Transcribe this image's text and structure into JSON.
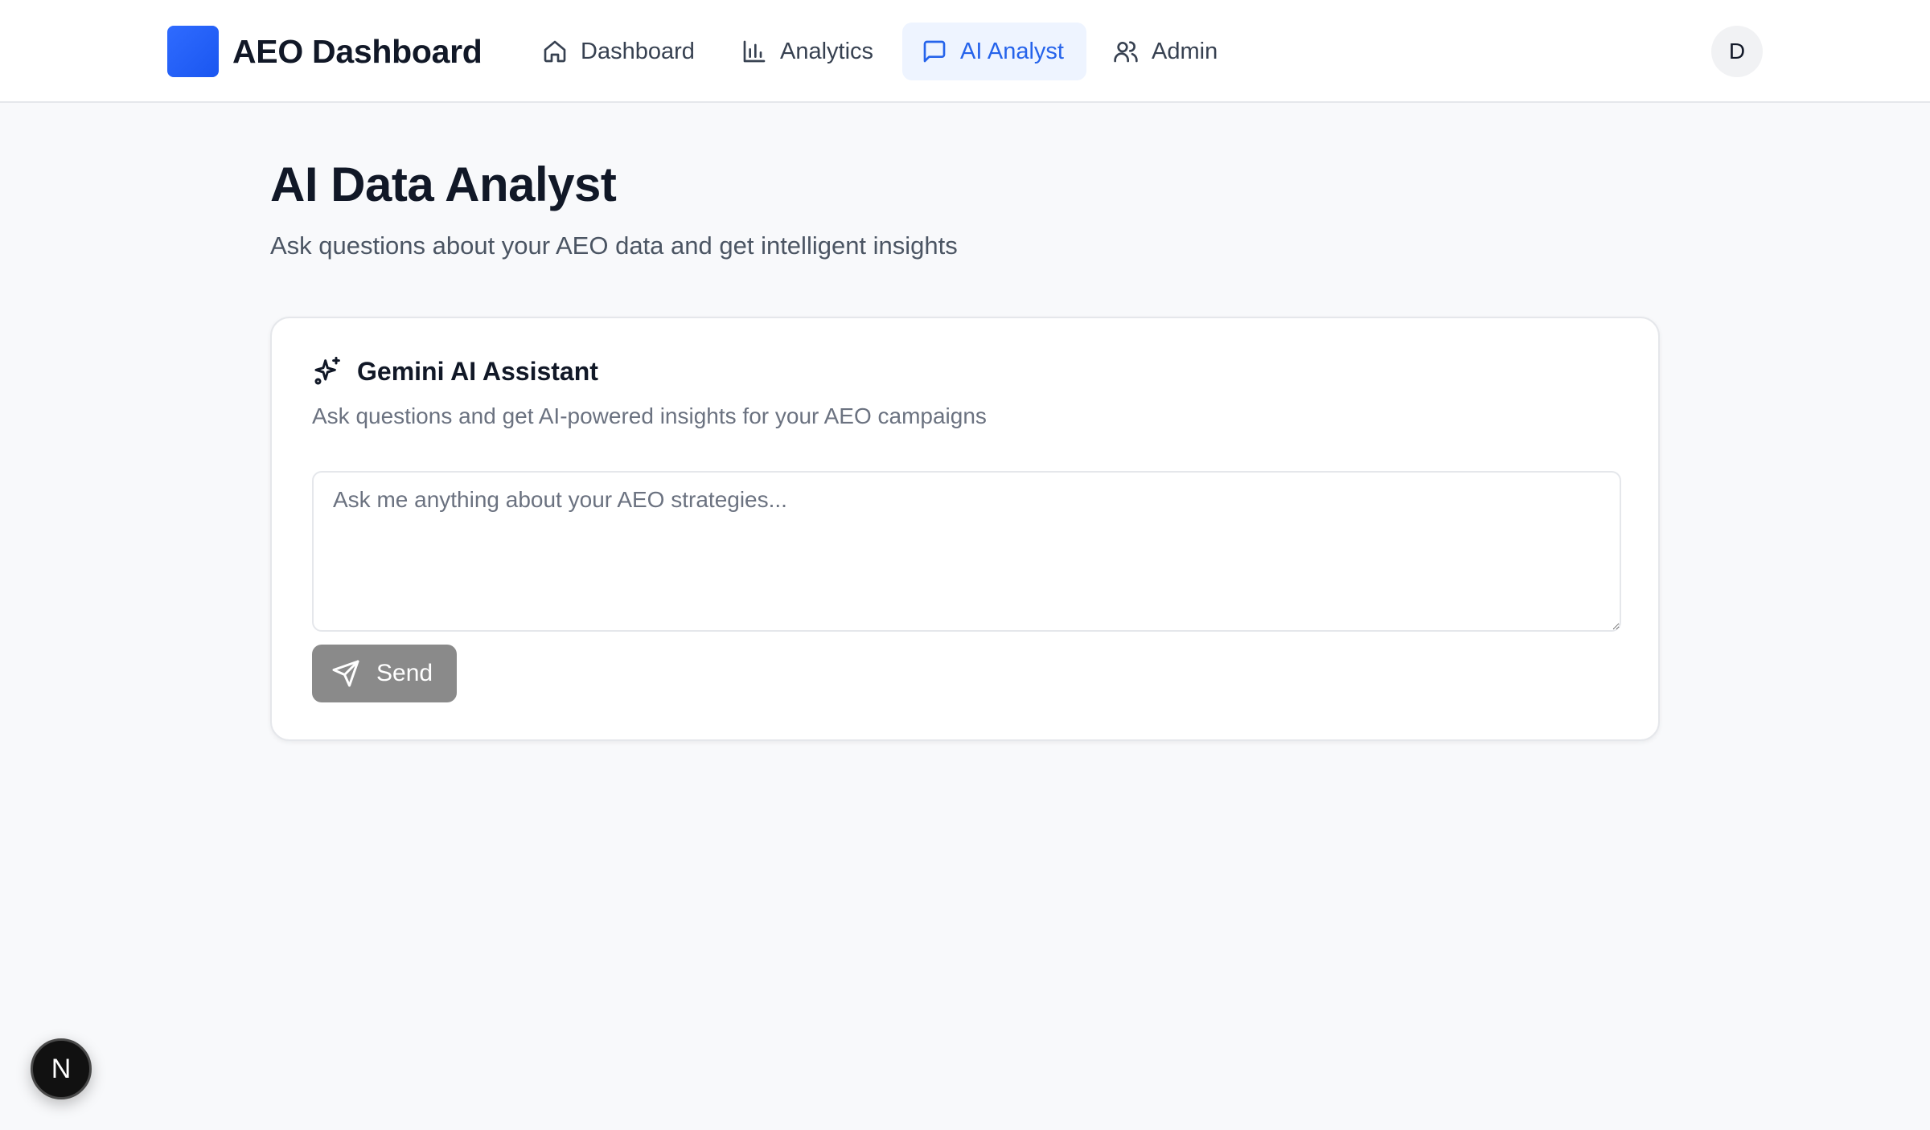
{
  "header": {
    "brand": "AEO Dashboard",
    "nav": [
      {
        "label": "Dashboard",
        "icon": "home-icon",
        "active": false
      },
      {
        "label": "Analytics",
        "icon": "bar-chart-icon",
        "active": false
      },
      {
        "label": "AI Analyst",
        "icon": "message-square-icon",
        "active": true
      },
      {
        "label": "Admin",
        "icon": "users-icon",
        "active": false
      }
    ],
    "avatar_initial": "D"
  },
  "page": {
    "title": "AI Data Analyst",
    "subtitle": "Ask questions about your AEO data and get intelligent insights"
  },
  "assistant": {
    "icon": "sparkles-icon",
    "title": "Gemini AI Assistant",
    "description": "Ask questions and get AI-powered insights for your AEO campaigns",
    "input_value": "",
    "input_placeholder": "Ask me anything about your AEO strategies...",
    "send_label": "Send",
    "send_icon": "send-icon"
  },
  "dev_badge": {
    "label": "N",
    "icon": "nextjs-icon"
  },
  "colors": {
    "accent": "#2563eb",
    "logo": "#1a56f0",
    "active_nav_bg": "#eef4ff",
    "send_disabled": "#8a8a8a",
    "page_bg": "#f8f9fb"
  }
}
